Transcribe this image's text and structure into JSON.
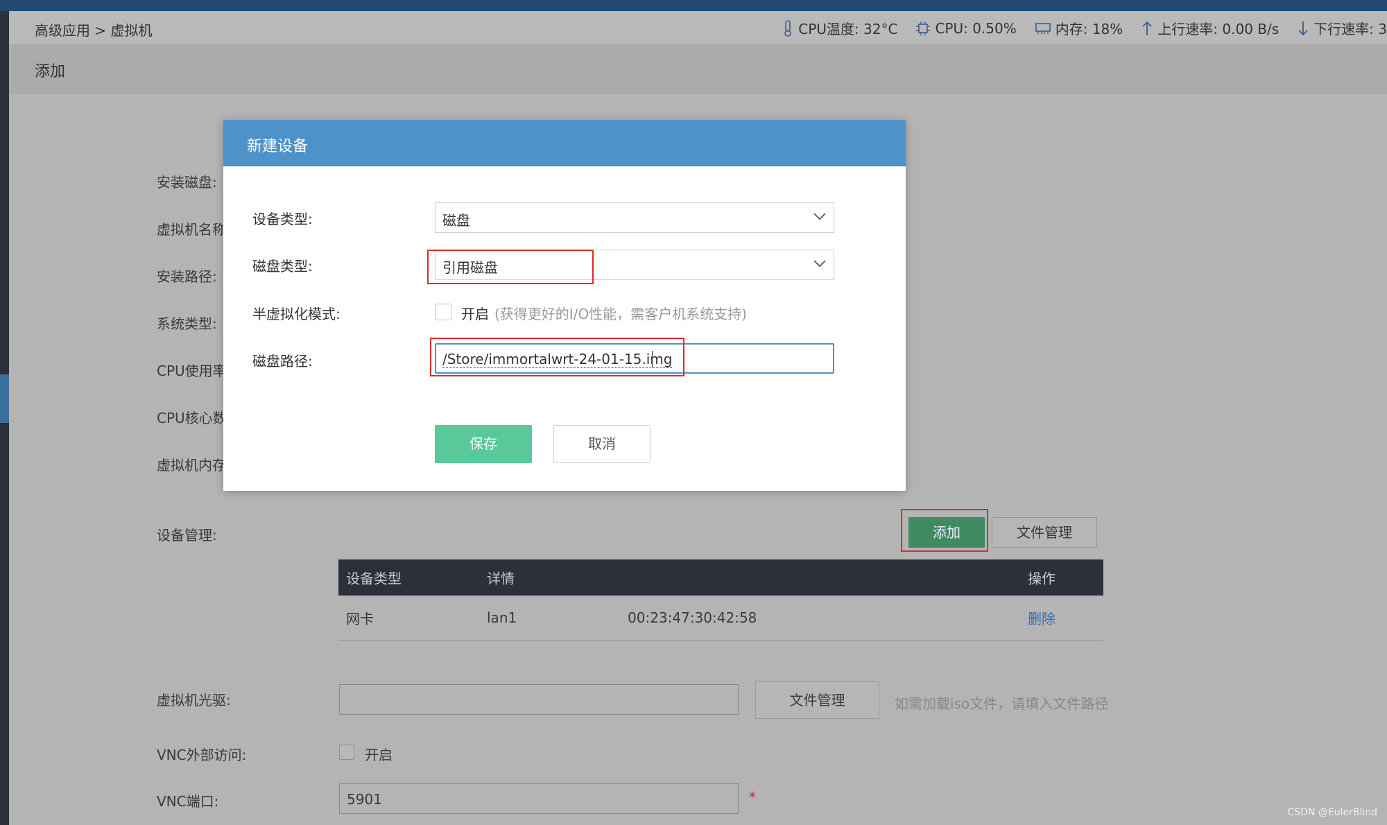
{
  "breadcrumb": "高级应用 > 虚拟机",
  "stats": {
    "cpu_temp": "CPU温度: 32°C",
    "cpu": "CPU: 0.50%",
    "memory": "内存: 18%",
    "upload": "上行速率: 0.00 B/s",
    "download": "下行速率: 3"
  },
  "page_title": "添加",
  "form_labels": {
    "install_disk": "安装磁盘:",
    "vm_name": "虚拟机名称",
    "install_path": "安装路径:",
    "system_type": "系统类型:",
    "cpu_usage": "CPU使用率",
    "cpu_cores": "CPU核心数",
    "vm_memory": "虚拟机内存",
    "device_mgmt": "设备管理:",
    "vm_cdrom": "虚拟机光驱:",
    "vnc_external": "VNC外部访问:",
    "vnc_port": "VNC端口:"
  },
  "device_buttons": {
    "add": "添加",
    "file_manage": "文件管理"
  },
  "device_table": {
    "headers": [
      "设备类型",
      "详情",
      "操作"
    ],
    "rows": [
      {
        "type": "网卡",
        "detail": "lan1",
        "mac": "00:23:47:30:42:58",
        "action": "删除"
      }
    ]
  },
  "cdrom": {
    "value": "",
    "button": "文件管理",
    "hint": "如需加载iso文件，请填入文件路径"
  },
  "vnc": {
    "toggle_label": "开启",
    "port_value": "5901",
    "required_mark": "*"
  },
  "modal": {
    "title": "新建设备",
    "device_type_label": "设备类型:",
    "device_type_value": "磁盘",
    "disk_type_label": "磁盘类型:",
    "disk_type_value": "引用磁盘",
    "para_label": "半虚拟化模式:",
    "para_toggle": "开启",
    "para_hint": "(获得更好的I/O性能，需客户机系统支持)",
    "disk_path_label": "磁盘路径:",
    "disk_path_value": "/Store/immortalwrt-24-01-15.img",
    "save": "保存",
    "cancel": "取消"
  },
  "watermark": "CSDN @EulerBlind",
  "colors": {
    "modal_header": "#4d92c9",
    "save": "#59c89a",
    "add": "#3f8a62",
    "highlight": "#e02a2a",
    "table_header": "#2d303b",
    "link": "#2f6fb0"
  }
}
